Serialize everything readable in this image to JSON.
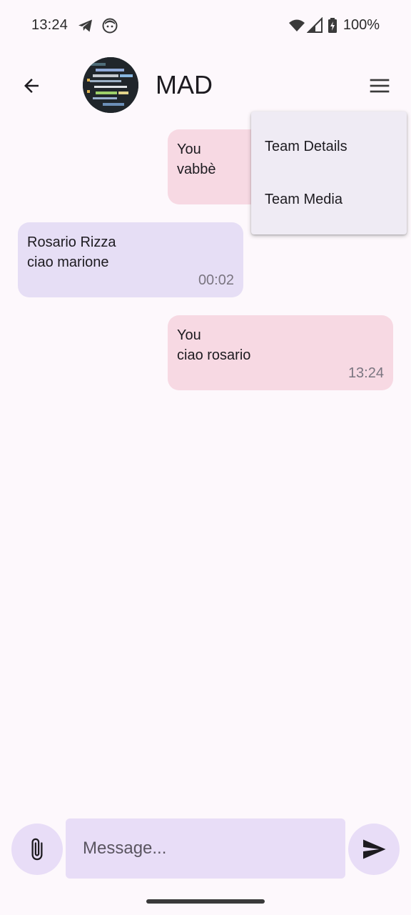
{
  "status_bar": {
    "time": "13:24",
    "battery": "100%",
    "icons": [
      "telegram-icon",
      "face-icon",
      "wifi-icon",
      "signal-icon",
      "battery-icon"
    ]
  },
  "header": {
    "title": "MAD",
    "back_icon": "arrow-back-icon",
    "menu_icon": "hamburger-menu-icon"
  },
  "messages": [
    {
      "sender": "You",
      "text": "vabbè",
      "time": "",
      "mine": true
    },
    {
      "sender": "Rosario Rizza",
      "text": "ciao marione",
      "time": "00:02",
      "mine": false
    },
    {
      "sender": "You",
      "text": "ciao rosario",
      "time": "13:24",
      "mine": true
    }
  ],
  "menu": {
    "items": [
      {
        "label": "Team Details"
      },
      {
        "label": "Team Media"
      }
    ]
  },
  "composer": {
    "placeholder": "Message...",
    "attach_icon": "paperclip-icon",
    "send_icon": "send-icon"
  },
  "colors": {
    "background": "#fdf8fc",
    "my_bubble": "#f7d9e3",
    "their_bubble": "#e6def5",
    "input_fill": "#e8ddf7",
    "menu_fill": "#efebf4"
  }
}
